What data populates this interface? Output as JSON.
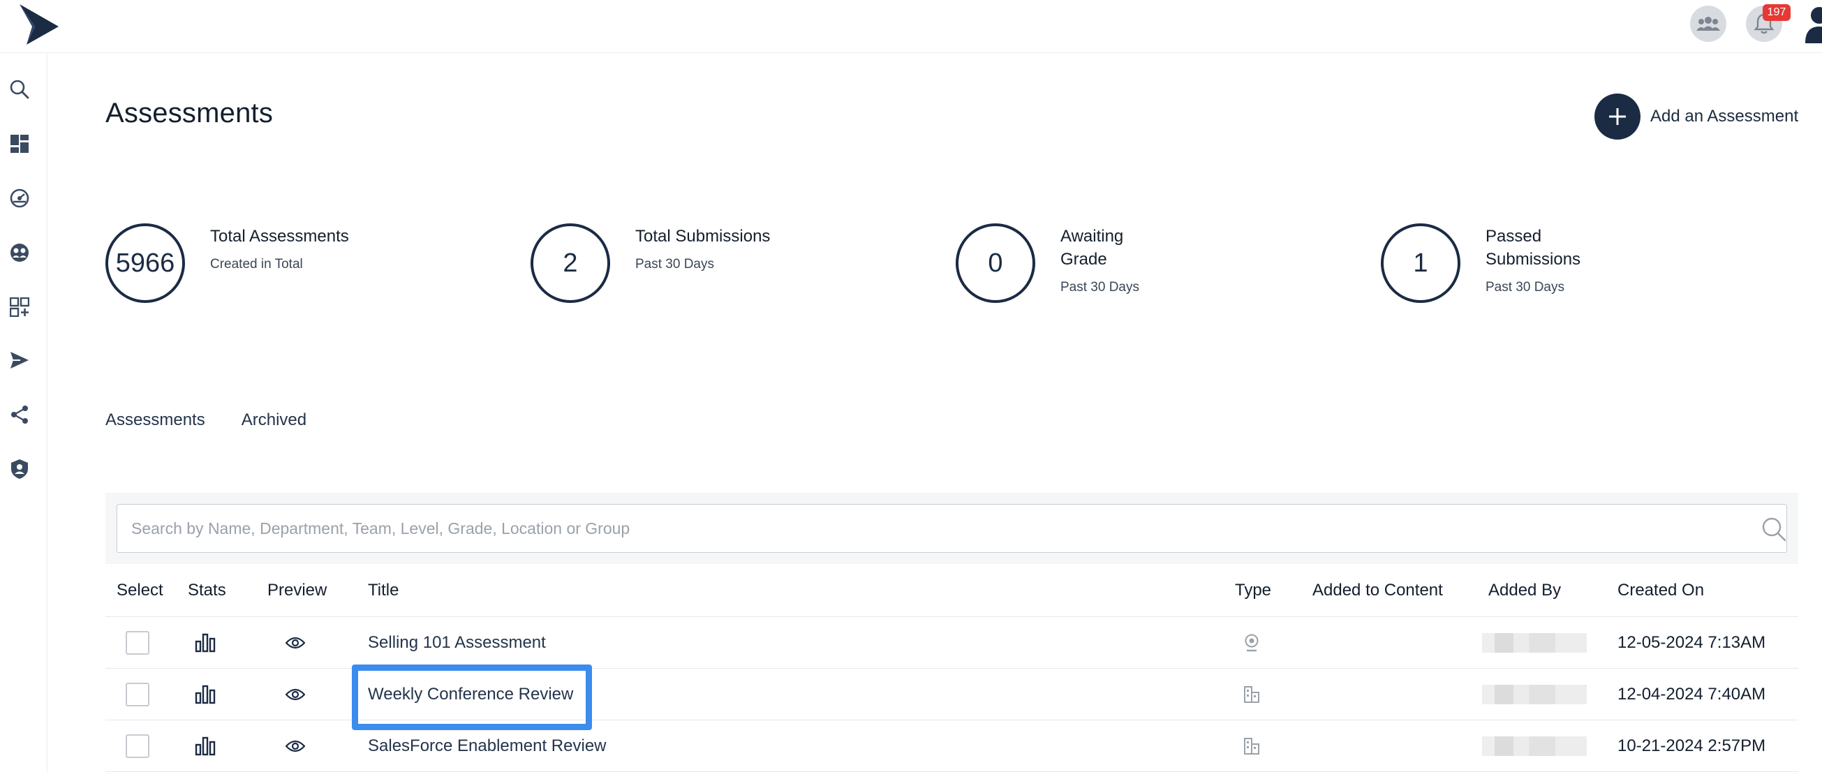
{
  "header": {
    "notification_count": "197"
  },
  "page": {
    "title": "Assessments",
    "add_label": "Add an Assessment"
  },
  "stats": [
    {
      "value": "5966",
      "label": "Total Assessments",
      "sub": "Created in Total"
    },
    {
      "value": "2",
      "label": "Total Submissions",
      "sub": "Past 30 Days"
    },
    {
      "value": "0",
      "label": "Awaiting Grade",
      "sub": "Past 30 Days"
    },
    {
      "value": "1",
      "label": "Passed Submissions",
      "sub": "Past 30 Days"
    }
  ],
  "tabs": [
    {
      "label": "Assessments"
    },
    {
      "label": "Archived"
    }
  ],
  "search": {
    "placeholder": "Search by Name, Department, Team, Level, Grade, Location or Group"
  },
  "table": {
    "columns": [
      "Select",
      "Stats",
      "Preview",
      "Title",
      "Type",
      "Added to Content",
      "Added By",
      "Created On"
    ],
    "rows": [
      {
        "title": "Selling 101 Assessment",
        "type_icon": "webcam-icon",
        "created_on": "12-05-2024 7:13AM"
      },
      {
        "title": "Weekly Conference Review",
        "type_icon": "building-icon",
        "created_on": "12-04-2024 7:40AM"
      },
      {
        "title": "SalesForce Enablement Review",
        "type_icon": "building-icon",
        "created_on": "10-21-2024 2:57PM"
      }
    ]
  },
  "colors": {
    "navy": "#1b2b44",
    "highlight": "#3b8ced",
    "badge": "#e53935"
  }
}
